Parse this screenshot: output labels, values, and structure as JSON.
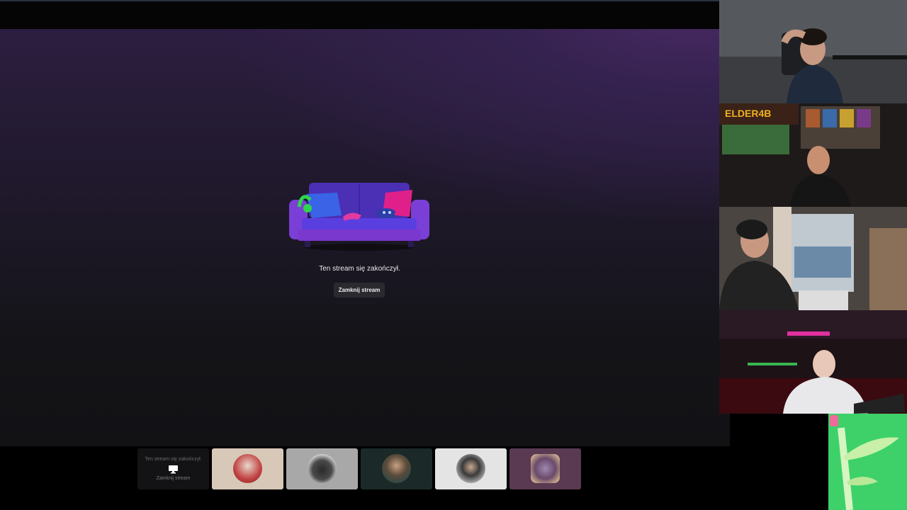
{
  "stream": {
    "ended_message": "Ten stream się zakończył.",
    "close_label": "Zamknij stream"
  },
  "cams": {
    "overlay_logo": "ELDER4B"
  },
  "thumbnails": [
    {
      "type": "ended",
      "message": "Ten stream się zakończył.",
      "close_label": "Zamknij stream",
      "icon": "monitor-icon"
    },
    {
      "type": "avatar",
      "bg": "#d8c8b8",
      "avatar_bg": "#c04040"
    },
    {
      "type": "avatar",
      "bg": "#a8a8a8",
      "avatar_bg": "#3a3a3a"
    },
    {
      "type": "avatar",
      "bg": "#1b2a28",
      "avatar_bg": "#2e4a46"
    },
    {
      "type": "avatar",
      "bg": "#e4e4e4",
      "avatar_bg": "#bcbcbc"
    },
    {
      "type": "avatar",
      "bg": "#5a3a52",
      "avatar_bg": "#8a6a88"
    }
  ],
  "colors": {
    "accent_purple": "#5a3fd0",
    "couch_purple": "#6a34c8",
    "pillow_pink": "#e0208a",
    "headphones_green": "#2fd54a"
  }
}
